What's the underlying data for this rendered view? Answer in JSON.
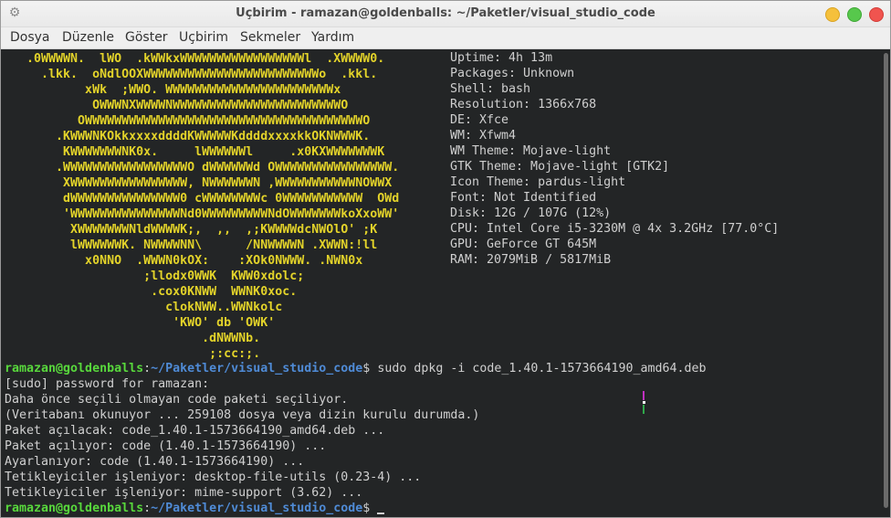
{
  "window": {
    "title": "Uçbirim - ramazan@goldenballs: ~/Paketler/visual_studio_code"
  },
  "menu": [
    "Dosya",
    "Düzenle",
    "Göster",
    "Uçbirim",
    "Sekmeler",
    "Yardım"
  ],
  "ascii_art": [
    "   .0WWWWN.  lWO  .kWWkxWWWWWWWWWWWWWWWWWl  .XWWWW0.",
    "     .lkk.  oNdlOOXWWWWWWWWWWWWWWWWWWWWWWWWo  .kkl.",
    "           xWk  ;WWO. WWWWWWWWWWWWWWWWWWWWWWWx",
    "            OWWWNXWWWWNWWWWWWWWWWWWWWWWWWWWWWWO",
    "          OWWWWWWWWWWWWWWWWWWWWWWWWWWWWWWWWWWWWWWO",
    "       .KWWWNKOkkxxxxddddKWWWWWKddddxxxxkkOKNWWWK.",
    "        KWWWWWWWNK0x.     lWWWWWWl     .x0KXWWWWWWWK",
    "       .WWWWWWWWWWWWWWWWWO dWWWWWWd OWWWWWWWWWWWWWWWW.",
    "        XWWWWWWWWWWWWWWWW, NWWWWWWN ,WWWWWWWWWWWNOWWX",
    "        dWWWWWWWWWWWWWWW0 cWWWWWWWWc 0WWWWWWWWWWW  OWd",
    "        'WWWWWWWWWWWWWWWNd0WWWWWWWWWNdOWWWWWWWkoXxoWW'",
    "         XWWWWWWWNldWWWWK;,  ,,  ,;KWWWWdcNWOlO' ;K",
    "         lWWWWWWK. NWWWWNN\\      /NNWWWWN .XWWN:!ll",
    "           x0NNO  .WWWN0kOX:    :XOk0NWWW. .NWN0x",
    "                   ;llodx0WWK  KWW0xdolc;",
    "                    .cox0KNWW  WWNK0xoc.",
    "                      clokNWW..WWNkolc",
    "                       'KWO' db 'OWK'",
    "                           .dNWWNb.",
    "                            ;:cc:;."
  ],
  "sysinfo": [
    "Uptime: 4h 13m",
    "Packages: Unknown",
    "Shell: bash",
    "Resolution: 1366x768",
    "DE: Xfce",
    "WM: Xfwm4",
    "WM Theme: Mojave-light",
    "GTK Theme: Mojave-light [GTK2]",
    "Icon Theme: pardus-light",
    "Font: Not Identified",
    "Disk: 12G / 107G (12%)",
    "CPU: Intel Core i5-3230M @ 4x 3.2GHz [77.0°C]",
    "GPU: GeForce GT 645M",
    "RAM: 2079MiB / 5817MiB"
  ],
  "prompt": {
    "user_host": "ramazan@goldenballs",
    "sep": ":",
    "path": "~/Paketler/visual_studio_code",
    "symbol": "$"
  },
  "command": " sudo dpkg -i code_1.40.1-1573664190_amd64.deb",
  "output": [
    "[sudo] password for ramazan:",
    "Daha önce seçili olmayan code paketi seçiliyor.",
    "(Veritabanı okunuyor ... 259108 dosya veya dizin kurulu durumda.)",
    "Paket açılacak: code_1.40.1-1573664190_amd64.deb ...",
    "Paket açılıyor: code (1.40.1-1573664190) ...",
    "Ayarlanıyor: code (1.40.1-1573664190) ...",
    "Tetikleyiciler işleniyor: desktop-file-utils (0.23-4) ...",
    "Tetikleyiciler işleniyor: mime-support (3.62) ..."
  ]
}
